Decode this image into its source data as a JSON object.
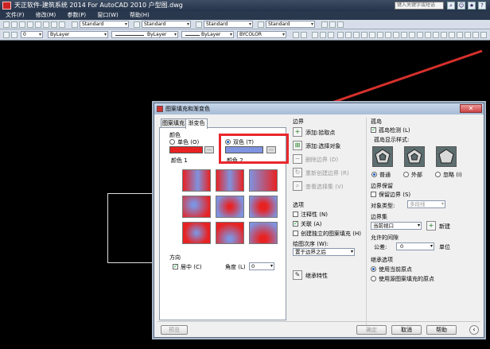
{
  "app": {
    "title": "天正软件-建筑系统 2014  For AutoCAD 2010      户型图.dwg",
    "search_placeholder": "键入关键字或短语"
  },
  "menu": [
    "文件(F)",
    "修改(M)",
    "参数(P)",
    "窗口(W)",
    "帮助(H)"
  ],
  "toolbar": {
    "style1": "Standard",
    "style2": "Standard",
    "style3": "Standard",
    "style4": "Standard",
    "layer": "0",
    "color": "ByLayer",
    "linetype": "ByLayer",
    "lineweight": "ByLayer",
    "plotstyle": "BYCOLOR"
  },
  "dialog": {
    "title": "图案填充和渐变色",
    "tabs": [
      "图案填充",
      "渐变色"
    ],
    "color_group": "颜色",
    "single_color": "单色 (O)",
    "two_color": "双色 (T)",
    "color1_label": "颜色 1",
    "color2_label": "颜色 2",
    "color1_hex": "#e82222",
    "color2_hex": "#7f93e0",
    "orientation_group": "方向",
    "centered": "居中 (C)",
    "angle_label": "角度 (L)",
    "angle_value": "0",
    "preview_button": "预览",
    "boundary": {
      "title": "边界",
      "add_pick": "添加:拾取点",
      "add_select": "添加:选择对象",
      "remove": "删除边界 (D)",
      "recreate": "重新创建边界 (R)",
      "view": "查看选择集 (V)"
    },
    "options": {
      "title": "选项",
      "annotative": "注释性 (N)",
      "associative": "关联 (A)",
      "separate": "创建独立的图案填充 (H)",
      "draw_order_label": "绘图次序 (W):",
      "draw_order_value": "置于边界之后",
      "inherit": "继承特性"
    },
    "islands": {
      "title": "孤岛",
      "detect": "孤岛检测 (L)",
      "display_style": "孤岛显示样式:",
      "styles": [
        "普通",
        "外部",
        "忽略 (I)"
      ]
    },
    "boundary_retention": {
      "title": "边界保留",
      "retain": "保留边界 (S)",
      "object_type_label": "对象类型:",
      "object_type_value": "多段线"
    },
    "boundary_set": {
      "title": "边界集",
      "value": "当前视口",
      "new_button": "新建"
    },
    "gap_tolerance": {
      "title": "允许的间隙",
      "label": "公差:",
      "value": "0",
      "unit": "单位"
    },
    "inherit_options": {
      "title": "继承选项",
      "current_origin": "使用当前原点",
      "source_origin": "使用源图案填充的原点"
    },
    "buttons": {
      "ok": "确定",
      "cancel": "取消",
      "help": "帮助"
    }
  },
  "colors": {
    "highlight": "#e8282c",
    "arrow": "#d6302c"
  }
}
